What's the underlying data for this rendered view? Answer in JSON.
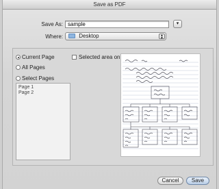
{
  "window": {
    "title": "Save as PDF"
  },
  "save_as": {
    "label": "Save As:",
    "value": "sample"
  },
  "where": {
    "label": "Where:",
    "value": "Desktop"
  },
  "range": {
    "current_page": "Current Page",
    "selected_area": "Selected area only",
    "all_pages": "All Pages",
    "select_pages": "Select Pages",
    "pages": [
      "Page 1",
      "Page 2"
    ]
  },
  "buttons": {
    "cancel": "Cancel",
    "save": "Save"
  }
}
